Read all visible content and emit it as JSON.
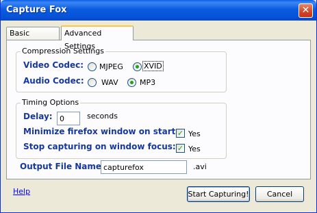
{
  "window": {
    "title": "Capture Fox",
    "close_glyph": "✕"
  },
  "tabs": [
    {
      "label": "Basic Settings",
      "active": false
    },
    {
      "label": "Advanced Settings",
      "active": true
    }
  ],
  "compression": {
    "legend": "Compression Settings",
    "video_label": "Video Codec:",
    "video_options": [
      {
        "label": "MJPEG",
        "selected": false
      },
      {
        "label": "XVID",
        "selected": true
      }
    ],
    "audio_label": "Audio Codec:",
    "audio_options": [
      {
        "label": "WAV",
        "selected": false
      },
      {
        "label": "MP3",
        "selected": true
      }
    ]
  },
  "timing": {
    "legend": "Timing Options",
    "delay_label": "Delay:",
    "delay_value": "0",
    "delay_unit": "seconds",
    "minimize_label": "Minimize firefox window on start:",
    "minimize_checked": true,
    "minimize_text": "Yes",
    "stop_label": "Stop capturing on window focus:",
    "stop_checked": true,
    "stop_text": "Yes"
  },
  "output": {
    "label": "Output File Name:",
    "value": "capturefox",
    "extension": ".avi"
  },
  "footer": {
    "help": "Help",
    "start_button": "Start Capturing!",
    "cancel_button": "Cancel"
  },
  "colors": {
    "title_bar": "#0a5ce0",
    "label_blue": "#16389e",
    "tab_highlight": "#ffc73c",
    "check_green": "#21a121"
  }
}
